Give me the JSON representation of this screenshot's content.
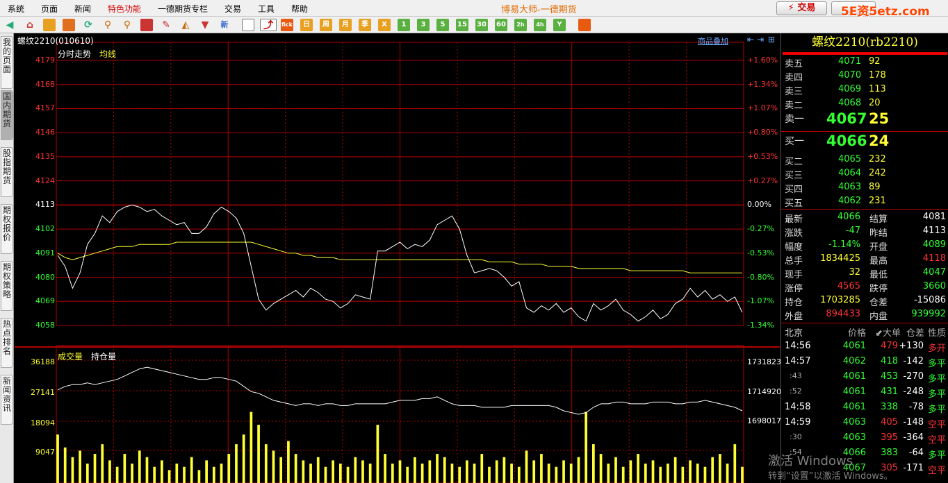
{
  "menu": {
    "items": [
      "系统",
      "页面",
      "新闻",
      "特色功能",
      "一德期货专栏",
      "交易",
      "工具",
      "帮助"
    ],
    "app_title": "博易大师-一德期货",
    "trade": "交易",
    "watermark": "5E资5etz.com"
  },
  "toolbar": {
    "fick": "fick",
    "period_labels": [
      "日",
      "周",
      "月",
      "季",
      "X",
      "1",
      "3",
      "5",
      "15",
      "30",
      "60",
      "2h",
      "4h",
      "Y"
    ]
  },
  "sidetabs": [
    "我的页面",
    "国内期货",
    "股指期货",
    "期权报价",
    "期权策略",
    "热点排名",
    "新闻资讯"
  ],
  "chart": {
    "contract_label": "螺纹2210(010610)",
    "overlay": "商品叠加",
    "legend_price": "分时走势",
    "legend_avg": "均线",
    "legend_vol": "成交量",
    "legend_oi": "持仓量",
    "price_ticks": [
      "4179",
      "4168",
      "4157",
      "4146",
      "4135",
      "4124",
      "4113",
      "4102",
      "4091",
      "4080",
      "4069",
      "4058"
    ],
    "pct_ticks": [
      "+1.60%",
      "+1.34%",
      "+1.07%",
      "+0.80%",
      "+0.53%",
      "+0.27%",
      "0.00%",
      "-0.27%",
      "-0.53%",
      "-0.80%",
      "-1.07%",
      "-1.34%"
    ],
    "vol_ticks": [
      "36188",
      "27141",
      "18094",
      "9047"
    ],
    "oi_ticks": [
      "1731823",
      "1714920",
      "1698017"
    ],
    "prev_settle": 4113
  },
  "chart_data": {
    "type": "line",
    "title": "螺纹2210 分时走势",
    "y_range": [
      4053,
      4180
    ],
    "series": [
      {
        "name": "分时走势",
        "values": [
          4090,
          4085,
          4075,
          4082,
          4095,
          4100,
          4108,
          4105,
          4110,
          4112,
          4113,
          4112,
          4110,
          4111,
          4108,
          4106,
          4104,
          4105,
          4100,
          4100,
          4103,
          4109,
          4112,
          4110,
          4107,
          4100,
          4085,
          4070,
          4065,
          4068,
          4070,
          4072,
          4074,
          4071,
          4075,
          4073,
          4070,
          4069,
          4066,
          4068,
          4072,
          4071,
          4070,
          4092,
          4092,
          4094,
          4096,
          4093,
          4095,
          4094,
          4097,
          4104,
          4106,
          4108,
          4102,
          4090,
          4082,
          4083,
          4084,
          4083,
          4080,
          4076,
          4078,
          4066,
          4064,
          4067,
          4065,
          4068,
          4064,
          4066,
          4062,
          4060,
          4068,
          4065,
          4067,
          4070,
          4065,
          4063,
          4060,
          4062,
          4065,
          4061,
          4063,
          4068,
          4070,
          4075,
          4071,
          4074,
          4070,
          4072,
          4069,
          4071,
          4064
        ]
      },
      {
        "name": "均线",
        "values": [
          4091,
          4089,
          4088,
          4089,
          4090,
          4091,
          4092,
          4093,
          4094,
          4094,
          4094,
          4095,
          4095,
          4095,
          4095,
          4095,
          4096,
          4096,
          4096,
          4096,
          4096,
          4096,
          4096,
          4096,
          4096,
          4096,
          4096,
          4095,
          4094,
          4093,
          4092,
          4091,
          4091,
          4090,
          4090,
          4089,
          4089,
          4089,
          4088,
          4088,
          4088,
          4088,
          4088,
          4088,
          4088,
          4088,
          4088,
          4088,
          4088,
          4088,
          4088,
          4088,
          4088,
          4088,
          4088,
          4088,
          4088,
          4088,
          4087,
          4087,
          4087,
          4087,
          4086,
          4086,
          4086,
          4086,
          4085,
          4085,
          4085,
          4085,
          4084,
          4084,
          4084,
          4084,
          4084,
          4084,
          4084,
          4083,
          4083,
          4083,
          4083,
          4083,
          4083,
          4083,
          4083,
          4082,
          4082,
          4082,
          4082,
          4082,
          4082,
          4082,
          4082
        ]
      },
      {
        "name": "持仓量",
        "values": [
          1716000,
          1718000,
          1719000,
          1719000,
          1720000,
          1719000,
          1720000,
          1721000,
          1722000,
          1724000,
          1726000,
          1728000,
          1729000,
          1728000,
          1727000,
          1726000,
          1725000,
          1724000,
          1723000,
          1722000,
          1722000,
          1723000,
          1723000,
          1722000,
          1721000,
          1718000,
          1715000,
          1714000,
          1712000,
          1710000,
          1709000,
          1708000,
          1707000,
          1708000,
          1708000,
          1707000,
          1708000,
          1708000,
          1707000,
          1707000,
          1708000,
          1708000,
          1708000,
          1708000,
          1708000,
          1709000,
          1710000,
          1710000,
          1710000,
          1711000,
          1711000,
          1712000,
          1710000,
          1708000,
          1707000,
          1707000,
          1707000,
          1706000,
          1706000,
          1706000,
          1706000,
          1707000,
          1707000,
          1707000,
          1707000,
          1707000,
          1707000,
          1706000,
          1704000,
          1703000,
          1702000,
          1703000,
          1706000,
          1708000,
          1708000,
          1709000,
          1709000,
          1708000,
          1708000,
          1708000,
          1709000,
          1709000,
          1709000,
          1708000,
          1708000,
          1709000,
          1709000,
          1710000,
          1709000,
          1708000,
          1707000,
          1706000,
          1704000
        ]
      },
      {
        "name": "成交量",
        "values": [
          15000,
          11000,
          8000,
          10000,
          6000,
          9000,
          12000,
          7000,
          5000,
          9000,
          6000,
          10000,
          8000,
          5000,
          7000,
          4000,
          6000,
          5000,
          8000,
          4000,
          7000,
          5000,
          6000,
          9000,
          12000,
          15000,
          22000,
          18000,
          12000,
          10000,
          8000,
          13000,
          9000,
          7000,
          6000,
          8000,
          5000,
          7000,
          6000,
          5000,
          8000,
          7000,
          6000,
          18000,
          9000,
          6000,
          7000,
          5000,
          8000,
          6000,
          7000,
          9000,
          8000,
          6000,
          5000,
          7000,
          6000,
          9000,
          5000,
          7000,
          8000,
          6000,
          5000,
          10000,
          7000,
          9000,
          6000,
          5000,
          7000,
          6000,
          8000,
          22000,
          12000,
          9000,
          6000,
          8000,
          5000,
          7000,
          9000,
          6000,
          7000,
          5000,
          6000,
          8000,
          5000,
          7000,
          6000,
          5000,
          8000,
          9000,
          6000,
          12000,
          5000
        ]
      }
    ],
    "x_count": 93
  },
  "quote": {
    "title": "螺纹2210(rb2210)",
    "asks": [
      {
        "label": "卖五",
        "price": "4071",
        "vol": "92"
      },
      {
        "label": "卖四",
        "price": "4070",
        "vol": "178"
      },
      {
        "label": "卖三",
        "price": "4069",
        "vol": "113"
      },
      {
        "label": "卖二",
        "price": "4068",
        "vol": "20"
      },
      {
        "label": "卖一",
        "price": "4067",
        "vol": "25"
      }
    ],
    "bids": [
      {
        "label": "买一",
        "price": "4066",
        "vol": "24"
      },
      {
        "label": "买二",
        "price": "4065",
        "vol": "232"
      },
      {
        "label": "买三",
        "price": "4064",
        "vol": "242"
      },
      {
        "label": "买四",
        "price": "4063",
        "vol": "89"
      },
      {
        "label": "买五",
        "price": "4062",
        "vol": "231"
      }
    ],
    "stats": [
      {
        "l1": "最新",
        "v1": "4066",
        "c1": "g",
        "l2": "结算",
        "v2": "4081",
        "c2": "w"
      },
      {
        "l1": "涨跌",
        "v1": "-47",
        "c1": "g",
        "l2": "昨结",
        "v2": "4113",
        "c2": "w"
      },
      {
        "l1": "幅度",
        "v1": "-1.14%",
        "c1": "g",
        "l2": "开盘",
        "v2": "4089",
        "c2": "g"
      },
      {
        "l1": "总手",
        "v1": "1834425",
        "c1": "y",
        "l2": "最高",
        "v2": "4118",
        "c2": "r"
      },
      {
        "l1": "现手",
        "v1": "32",
        "c1": "y",
        "l2": "最低",
        "v2": "4047",
        "c2": "g"
      },
      {
        "l1": "涨停",
        "v1": "4565",
        "c1": "r",
        "l2": "跌停",
        "v2": "3660",
        "c2": "g"
      },
      {
        "l1": "持仓",
        "v1": "1703285",
        "c1": "y",
        "l2": "仓差",
        "v2": "-15086",
        "c2": "w"
      },
      {
        "l1": "外盘",
        "v1": "894433",
        "c1": "r",
        "l2": "内盘",
        "v2": "939992",
        "c2": "g"
      }
    ],
    "tick_headers": [
      "北京",
      "价格",
      "⬋大单",
      "仓差",
      "性质"
    ],
    "ticks": [
      {
        "t": "14:56",
        "p": "4061",
        "v": "479",
        "vc": "r",
        "d": "+130",
        "n": "多开",
        "nc": "r"
      },
      {
        "t": "14:57",
        "p": "4062",
        "v": "418",
        "vc": "g",
        "d": "-142",
        "n": "多平",
        "nc": "g"
      },
      {
        "t": ":43",
        "p": "4061",
        "v": "453",
        "vc": "g",
        "d": "-270",
        "n": "多平",
        "nc": "g"
      },
      {
        "t": ":52",
        "p": "4061",
        "v": "431",
        "vc": "g",
        "d": "-248",
        "n": "多平",
        "nc": "g"
      },
      {
        "t": "14:58",
        "p": "4061",
        "v": "338",
        "vc": "g",
        "d": "-78",
        "n": "多平",
        "nc": "g"
      },
      {
        "t": "14:59",
        "p": "4063",
        "v": "405",
        "vc": "r",
        "d": "-148",
        "n": "空平",
        "nc": "r"
      },
      {
        "t": ":30",
        "p": "4063",
        "v": "395",
        "vc": "r",
        "d": "-364",
        "n": "空平",
        "nc": "r"
      },
      {
        "t": ":54",
        "p": "4066",
        "v": "383",
        "vc": "g",
        "d": "-64",
        "n": "多平",
        "nc": "g"
      },
      {
        "t": "",
        "p": "4067",
        "v": "305",
        "vc": "r",
        "d": "-171",
        "n": "空平",
        "nc": "r"
      }
    ]
  },
  "overlay_text": {
    "activate": "激活 Windows",
    "hint": "转到“设置”以激活 Windows。"
  }
}
